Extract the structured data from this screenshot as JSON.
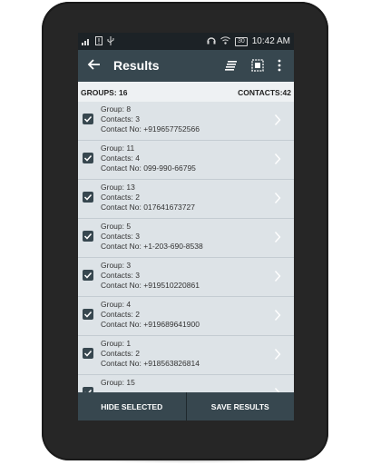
{
  "status": {
    "left_icons": [
      "signal-bars-icon",
      "sim-alert-icon",
      "usb-icon"
    ],
    "right_icons": [
      "headset-icon",
      "wifi-icon",
      "battery-icon"
    ],
    "battery_badge": "30",
    "time": "10:42 AM"
  },
  "appbar": {
    "title": "Results",
    "icons": [
      "back-arrow-icon",
      "sort-icon",
      "select-all-icon",
      "more-vert-icon"
    ]
  },
  "summary": {
    "groups": "GROUPS: 16",
    "contacts": "CONTACTS:42"
  },
  "rows": [
    {
      "group": "Group: 8",
      "contacts": "Contacts: 3",
      "number": "Contact No: +919657752566"
    },
    {
      "group": "Group: 11",
      "contacts": "Contacts: 4",
      "number": "Contact No: 099-990-66795"
    },
    {
      "group": "Group: 13",
      "contacts": "Contacts: 2",
      "number": "Contact No: 017641673727"
    },
    {
      "group": "Group: 5",
      "contacts": "Contacts: 3",
      "number": "Contact No: +1-203-690-8538"
    },
    {
      "group": "Group: 3",
      "contacts": "Contacts: 3",
      "number": "Contact No: +919510220861"
    },
    {
      "group": "Group: 4",
      "contacts": "Contacts: 2",
      "number": "Contact No: +919689641900"
    },
    {
      "group": "Group: 1",
      "contacts": "Contacts: 2",
      "number": "Contact No: +918563826814"
    },
    {
      "group": "Group: 15",
      "contacts": "",
      "number": ""
    }
  ],
  "buttons": {
    "hide": "HIDE SELECTED",
    "save": "SAVE RESULTS"
  },
  "colors": {
    "appbar": "#37474f",
    "statusbar": "#1c2226",
    "row": "#dde3e7",
    "background": "#eef1f3"
  }
}
